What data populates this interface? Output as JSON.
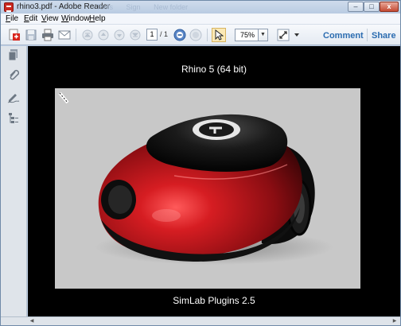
{
  "window": {
    "title": "rhino3.pdf - Adobe Reader",
    "ghost_tabs": [
      "Tools",
      "Sign",
      "New folder"
    ],
    "controls": {
      "minimize": "–",
      "maximize": "□",
      "close": "x"
    }
  },
  "menu": {
    "items": [
      "File",
      "Edit",
      "View",
      "Window",
      "Help"
    ]
  },
  "toolbar": {
    "page_current": "1",
    "page_total": "/ 1",
    "zoom": "75%",
    "comment_label": "Comment",
    "share_label": "Share",
    "icons": [
      "create-pdf-icon",
      "save-icon",
      "print-icon",
      "email-icon",
      "first-page-icon",
      "previous-page-icon",
      "next-page-icon",
      "last-page-icon",
      "zoom-out-icon",
      "zoom-in-icon",
      "select-tool-icon",
      "hand-tool-icon",
      "fit-page-icon",
      "more-tools-icon"
    ]
  },
  "nav_panel": {
    "icons": [
      "pages-icon",
      "attachments-icon",
      "signatures-icon",
      "layers-icon"
    ]
  },
  "document": {
    "title": "Rhino 5 (64 bit)",
    "footer": "SimLab Plugins 2.5",
    "image": "3D render of a red and black mouse-shaped device",
    "colors": {
      "background": "#000000",
      "render_bg": "#c8c8c8",
      "body_red": "#b3121a",
      "body_black": "#141414"
    }
  }
}
